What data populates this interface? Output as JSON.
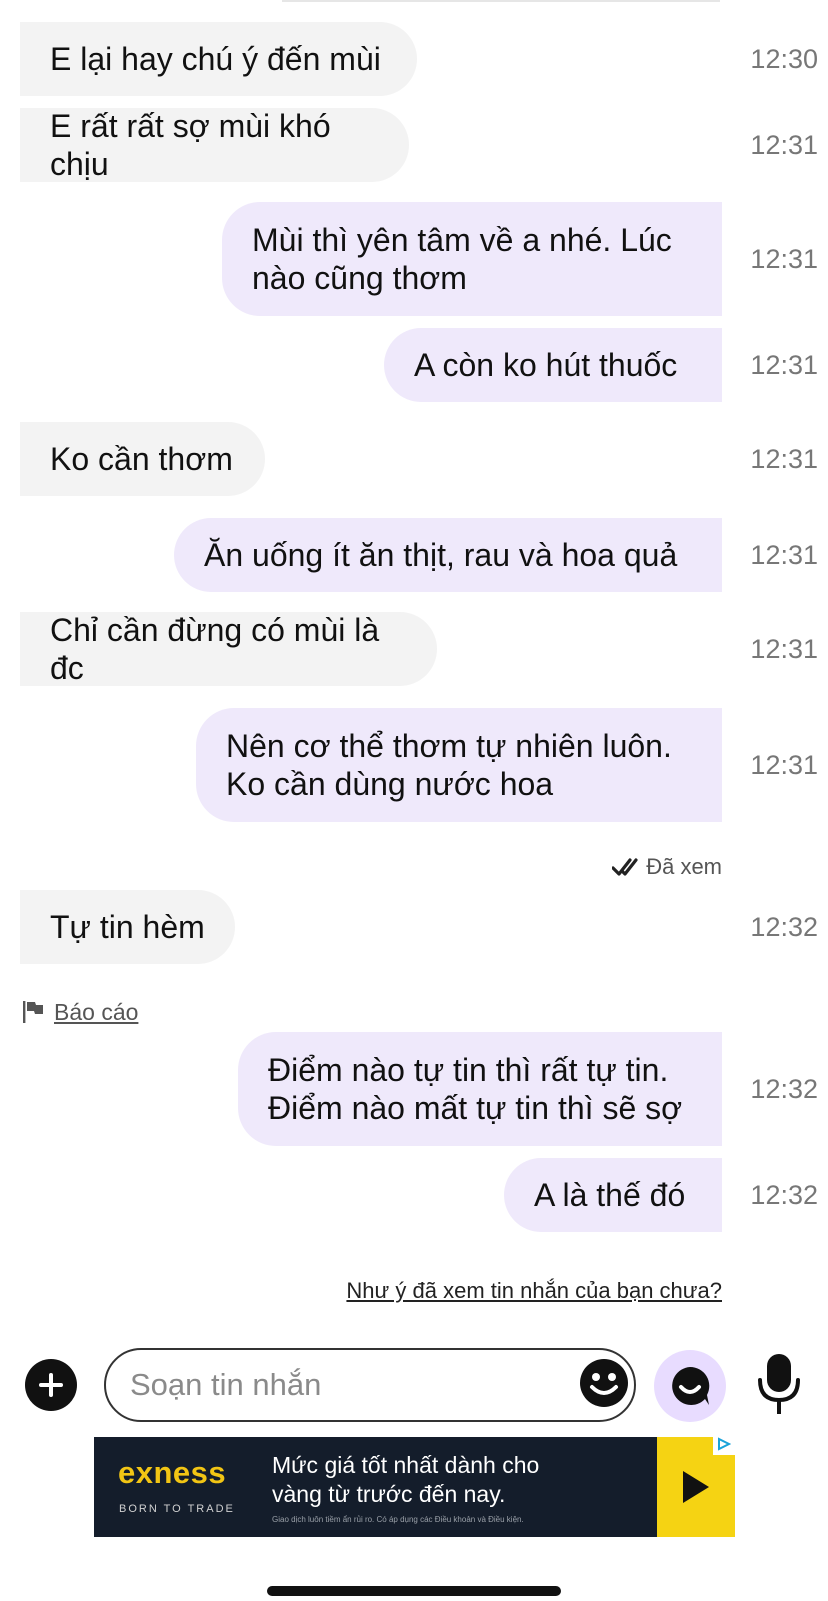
{
  "messages": [
    {
      "dir": "in",
      "text": "E lại hay chú ý đến mùi",
      "time": "12:30"
    },
    {
      "dir": "in",
      "text": "E rất rất sợ mùi khó chịu",
      "time": "12:31"
    },
    {
      "dir": "out",
      "text": "Mùi thì yên tâm về a nhé. Lúc\nnào cũng thơm",
      "time": "12:31"
    },
    {
      "dir": "out",
      "text": "A còn ko hút thuốc",
      "time": "12:31"
    },
    {
      "dir": "in",
      "text": "Ko cần thơm",
      "time": "12:31"
    },
    {
      "dir": "out",
      "text": "Ăn uống ít ăn thịt, rau và hoa quả",
      "time": "12:31"
    },
    {
      "dir": "in",
      "text": "Chỉ cần đừng có mùi là đc",
      "time": "12:31"
    },
    {
      "dir": "out",
      "text": "Nên cơ thể thơm tự nhiên luôn.\nKo cần dùng nước hoa",
      "time": "12:31"
    },
    {
      "dir": "in",
      "text": "Tự tin hèm",
      "time": "12:32"
    },
    {
      "dir": "out",
      "text": "Điểm nào tự tin thì rất tự tin.\nĐiểm nào mất tự tin thì sẽ sợ",
      "time": "12:32"
    },
    {
      "dir": "out",
      "text": "A là thế đó",
      "time": "12:32"
    }
  ],
  "seen_label": "Đã xem",
  "report_label": "Báo cáo",
  "seen_prompt": "Như ý đã xem tin nhắn của bạn chưa?",
  "composer": {
    "placeholder": "Soạn tin nhắn"
  },
  "ad": {
    "brand": "exness",
    "tagline": "BORN TO TRADE",
    "headline": "Mức giá tốt nhất dành cho\nvàng từ trước đến nay.",
    "fine_print": "Giao dịch luôn tiềm ẩn rủi ro. Có áp dụng các Điều khoản và Điều kiện."
  },
  "colors": {
    "incoming_bubble": "#f3f3f3",
    "outgoing_bubble": "#efe9fb",
    "accent": "#e8dcff",
    "ad_background": "#141d2b",
    "ad_accent": "#f5d313"
  }
}
